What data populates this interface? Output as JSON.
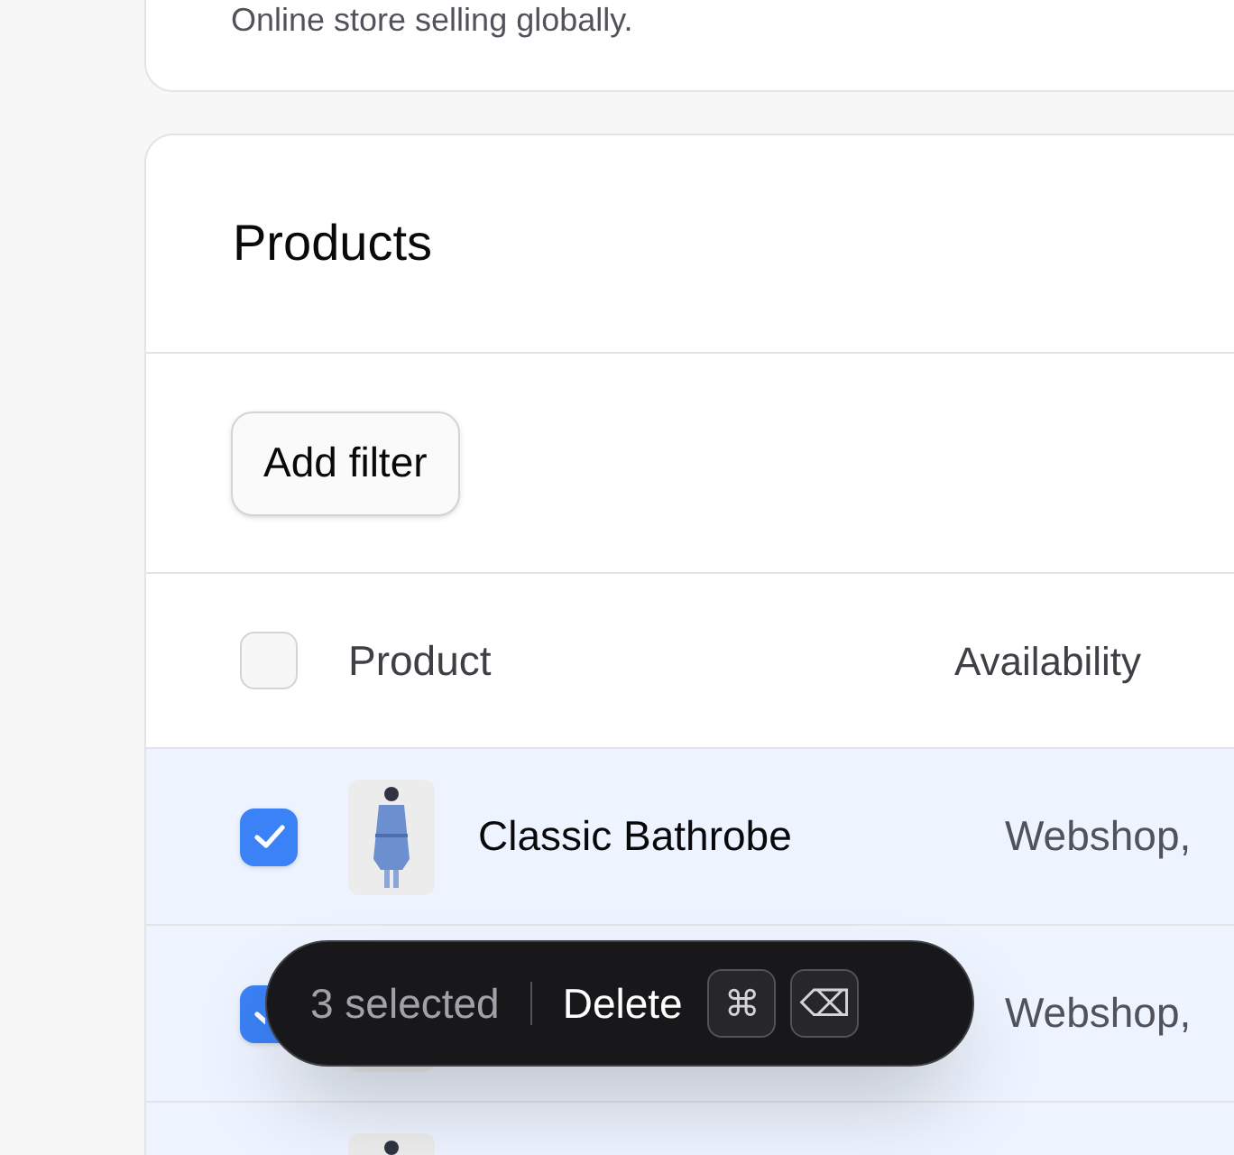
{
  "store_card": {
    "description": "Online store selling globally."
  },
  "products": {
    "title": "Products",
    "filter_button": "Add filter",
    "columns": [
      {
        "label": "Product"
      },
      {
        "label": "Availability"
      }
    ],
    "header_checkbox": {
      "checked": false
    },
    "rows": [
      {
        "selected": true,
        "name": "Classic Bathrobe",
        "availability": "Webshop,"
      },
      {
        "selected": true,
        "availability": "Webshop,"
      },
      {
        "selected": true
      }
    ]
  },
  "selection_bar": {
    "count": "3 selected",
    "action": "Delete",
    "shortcut": [
      "⌘",
      "⌫"
    ]
  }
}
